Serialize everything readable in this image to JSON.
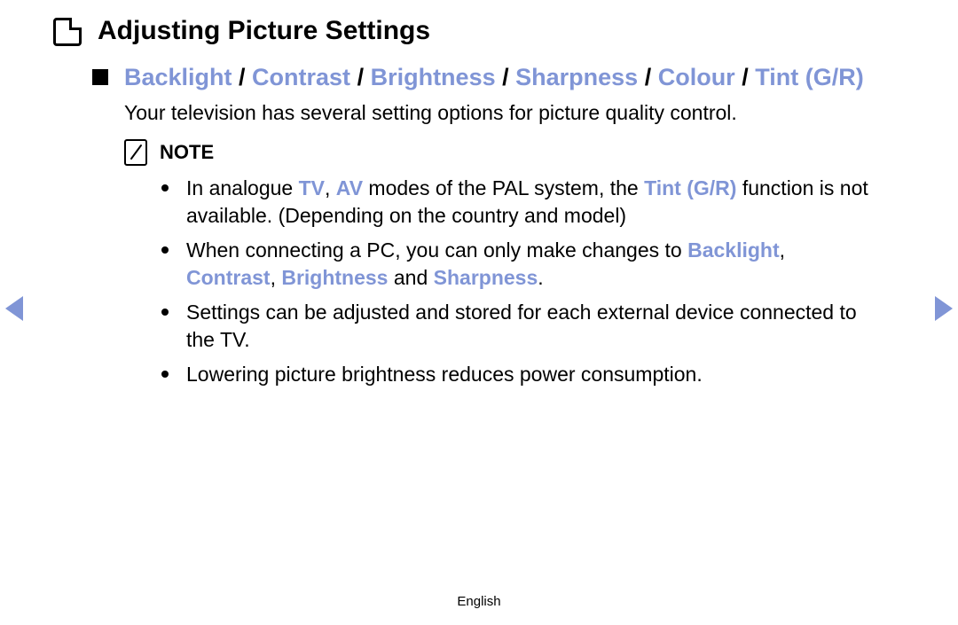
{
  "title": "Adjusting Picture Settings",
  "subheading": {
    "items": [
      "Backlight",
      "Contrast",
      "Brightness",
      "Sharpness",
      "Colour",
      "Tint (G/R)"
    ],
    "sep": " / "
  },
  "intro": "Your television has several setting options for picture quality control.",
  "note_label": "NOTE",
  "notes": {
    "n0": {
      "pre": "In analogue ",
      "k1": "TV",
      "mid1": ", ",
      "k2": "AV",
      "mid2": " modes of the PAL system, the ",
      "k3": "Tint (G/R)",
      "post": " function is not available. (Depending on the country and model)"
    },
    "n1": {
      "pre": "When connecting a PC, you can only make changes to ",
      "k1": "Backlight",
      "mid1": ", ",
      "k2": "Contrast",
      "mid2": ", ",
      "k3": "Brightness",
      "mid3": " and ",
      "k4": "Sharpness",
      "post": "."
    },
    "n2": "Settings can be adjusted and stored for each external device connected to the TV.",
    "n3": "Lowering picture brightness reduces power consumption."
  },
  "footer": "English"
}
